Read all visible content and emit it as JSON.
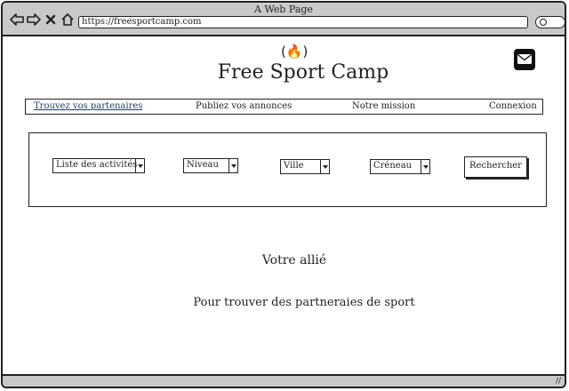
{
  "browser": {
    "window_title": "A Web Page",
    "url": "https://freesportcamp.com"
  },
  "header": {
    "logo_glyph": "(🔥)",
    "site_title": "Free Sport Camp",
    "mail_icon": "envelope-icon"
  },
  "nav": {
    "items": [
      {
        "label": "Trouvez vos partenaires",
        "active": true
      },
      {
        "label": "Publiez vos annonces",
        "active": false
      },
      {
        "label": "Notre mission",
        "active": false
      },
      {
        "label": "Connexion",
        "active": false
      }
    ]
  },
  "filters": {
    "activity": "Liste des activités",
    "level": "Niveau",
    "city": "Ville",
    "slot": "Créneau",
    "search_button": "Rechercher"
  },
  "main": {
    "tagline": "Votre allié",
    "subline": "Pour trouver des partneraies de sport"
  },
  "colors": {
    "chrome": "#c9c9c9",
    "active_link": "#1f3f66",
    "ink": "#222222"
  }
}
